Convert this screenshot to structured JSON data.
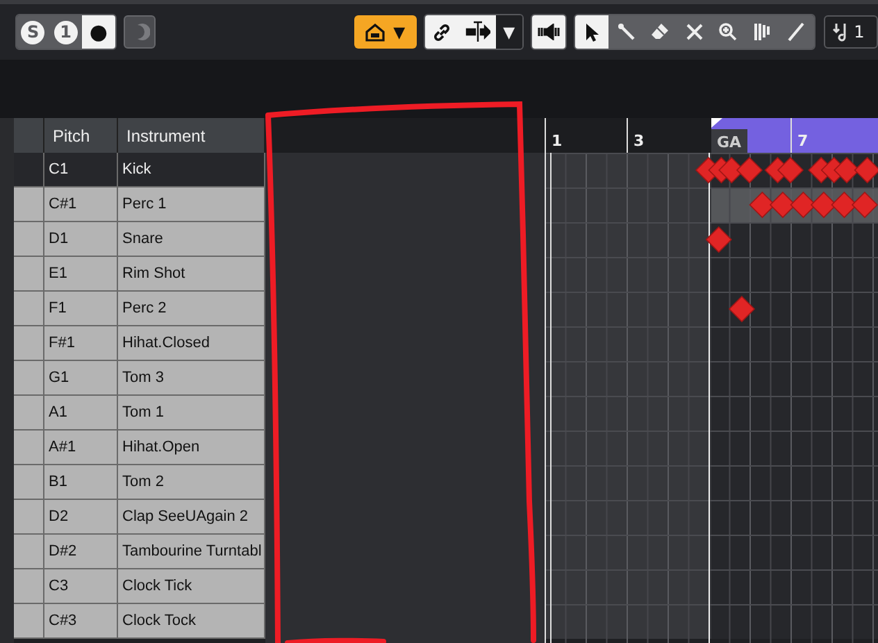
{
  "toolbar": {
    "mode_buttons": [
      {
        "label": "S",
        "selected": false
      },
      {
        "label": "1",
        "selected": false
      },
      {
        "label": "●",
        "selected": true
      }
    ],
    "feedback_button": {
      "disabled": true
    },
    "snap_caret": "▼",
    "split_caret": "▼",
    "tools": [
      {
        "kind": "arrow",
        "selected": true
      },
      {
        "kind": "line",
        "selected": false
      },
      {
        "kind": "eraser",
        "selected": false
      },
      {
        "kind": "mute",
        "selected": false
      },
      {
        "kind": "zoom",
        "selected": false
      },
      {
        "kind": "bars",
        "selected": false
      },
      {
        "kind": "draw",
        "selected": false
      }
    ],
    "quantize": {
      "value": "1"
    }
  },
  "drum_map": {
    "columns": [
      "Pitch",
      "Instrument"
    ],
    "rows": [
      {
        "pitch": "C1",
        "instrument": "Kick",
        "selected": true,
        "lane_highlight": false
      },
      {
        "pitch": "C#1",
        "instrument": "Perc 1",
        "selected": false,
        "lane_highlight": true
      },
      {
        "pitch": "D1",
        "instrument": "Snare",
        "selected": false,
        "lane_highlight": false
      },
      {
        "pitch": "E1",
        "instrument": "Rim Shot",
        "selected": false,
        "lane_highlight": false
      },
      {
        "pitch": "F1",
        "instrument": "Perc 2",
        "selected": false,
        "lane_highlight": false
      },
      {
        "pitch": "F#1",
        "instrument": "Hihat.Closed",
        "selected": false,
        "lane_highlight": false
      },
      {
        "pitch": "G1",
        "instrument": "Tom 3",
        "selected": false,
        "lane_highlight": false
      },
      {
        "pitch": "A1",
        "instrument": "Tom 1",
        "selected": false,
        "lane_highlight": false
      },
      {
        "pitch": "A#1",
        "instrument": "Hihat.Open",
        "selected": false,
        "lane_highlight": false
      },
      {
        "pitch": "B1",
        "instrument": "Tom 2",
        "selected": false,
        "lane_highlight": false
      },
      {
        "pitch": "D2",
        "instrument": "Clap SeeUAgain 2",
        "selected": false,
        "lane_highlight": false
      },
      {
        "pitch": "D#2",
        "instrument": "Tambourine Turntabl",
        "selected": false,
        "lane_highlight": false
      },
      {
        "pitch": "C3",
        "instrument": "Clock Tick",
        "selected": false,
        "lane_highlight": false
      },
      {
        "pitch": "C#3",
        "instrument": "Clock Tock",
        "selected": false,
        "lane_highlight": false
      }
    ]
  },
  "ruler": {
    "bars": [
      {
        "label": "1"
      },
      {
        "label": "3"
      },
      {
        "label": "7"
      }
    ],
    "marker": {
      "label": "GA"
    }
  },
  "annotation": {
    "kind": "outline"
  }
}
